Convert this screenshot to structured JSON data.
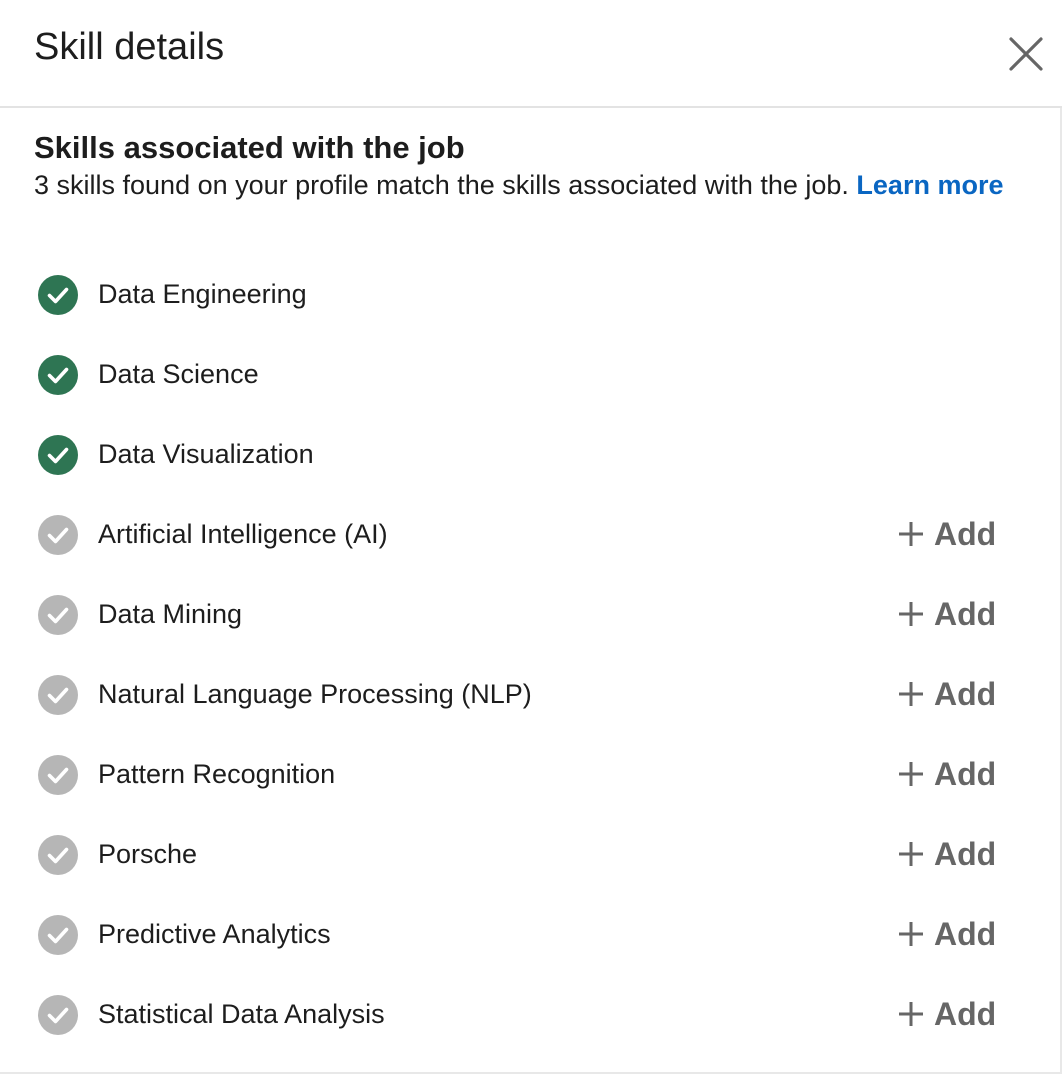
{
  "header": {
    "title": "Skill details",
    "close_icon": "close-icon"
  },
  "section": {
    "heading": "Skills associated with the job",
    "description": "3 skills found on your profile match the skills associated with the job.",
    "learn_more": "Learn more"
  },
  "colors": {
    "matched": "#2e7553",
    "unmatched": "#b6b6b6",
    "link": "#0a66c2",
    "add_text": "#666666"
  },
  "skills": [
    {
      "name": "Data Engineering",
      "matched": true
    },
    {
      "name": "Data Science",
      "matched": true
    },
    {
      "name": "Data Visualization",
      "matched": true
    },
    {
      "name": "Artificial Intelligence (AI)",
      "matched": false
    },
    {
      "name": "Data Mining",
      "matched": false
    },
    {
      "name": "Natural Language Processing (NLP)",
      "matched": false
    },
    {
      "name": "Pattern Recognition",
      "matched": false
    },
    {
      "name": "Porsche",
      "matched": false
    },
    {
      "name": "Predictive Analytics",
      "matched": false
    },
    {
      "name": "Statistical Data Analysis",
      "matched": false
    }
  ],
  "add_label": "Add"
}
